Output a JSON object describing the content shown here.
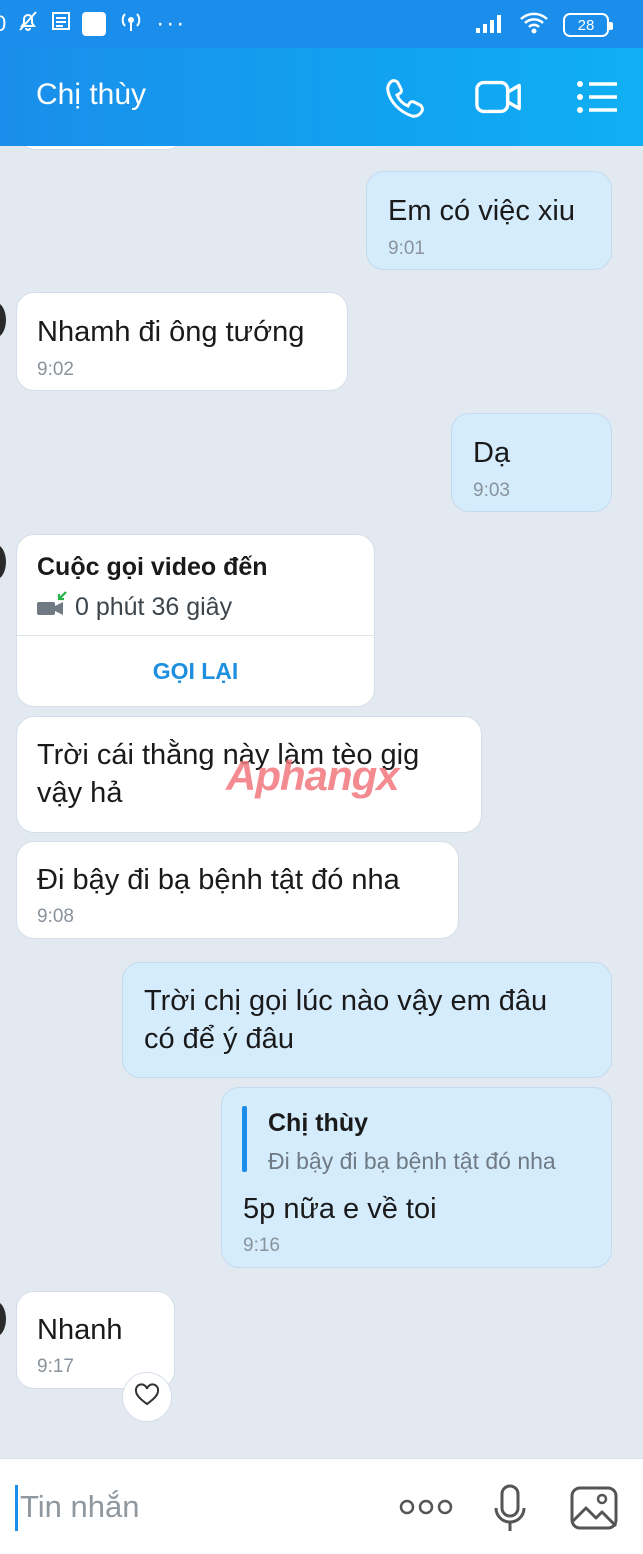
{
  "status_bar": {
    "left_glyphs": "0",
    "more": "···",
    "battery": "28"
  },
  "header": {
    "title": "Chị thùy"
  },
  "messages": [
    {
      "text": "Em có việc xiu",
      "time": "9:01"
    },
    {
      "text": "Nhamh đi ông tướng",
      "time": "9:02"
    },
    {
      "text": "Dạ",
      "time": "9:03"
    },
    {
      "call_title": "Cuộc gọi video đến",
      "call_duration": "0 phút 36 giây",
      "call_action": "GỌI LẠI"
    },
    {
      "text_line1": "Trời cái thằng này làm tèo gig",
      "text_line2": "vậy hả"
    },
    {
      "text": "Đi bậy đi bạ bệnh tật đó nha",
      "time": "9:08"
    },
    {
      "text_line1": "Trời chị gọi lúc nào vậy em đâu",
      "text_line2": "có để ý đâu"
    },
    {
      "quote_author": "Chị thùy",
      "quote_text": "Đi bậy đi bạ bệnh tật đó nha",
      "text": "5p nữa e về toi",
      "time": "9:16"
    },
    {
      "text": "Nhanh",
      "time": "9:17"
    }
  ],
  "watermark": "Aphangx",
  "input": {
    "placeholder": "Tin nhắn",
    "more": "ooo"
  },
  "colors": {
    "header": "#1a8eea",
    "outgoing_bubble": "#d5ecfd",
    "incoming_bubble": "#ffffff",
    "chat_bg": "#e2e9f1",
    "accent": "#1a8eea"
  },
  "icons": [
    "bell-off-icon",
    "news-icon",
    "hotspot-icon",
    "signal-icon",
    "wifi-icon",
    "battery-icon",
    "phone-icon",
    "video-call-icon",
    "menu-list-icon",
    "missed-video-call-icon",
    "heart-icon",
    "more-icon",
    "microphone-icon",
    "image-icon"
  ]
}
